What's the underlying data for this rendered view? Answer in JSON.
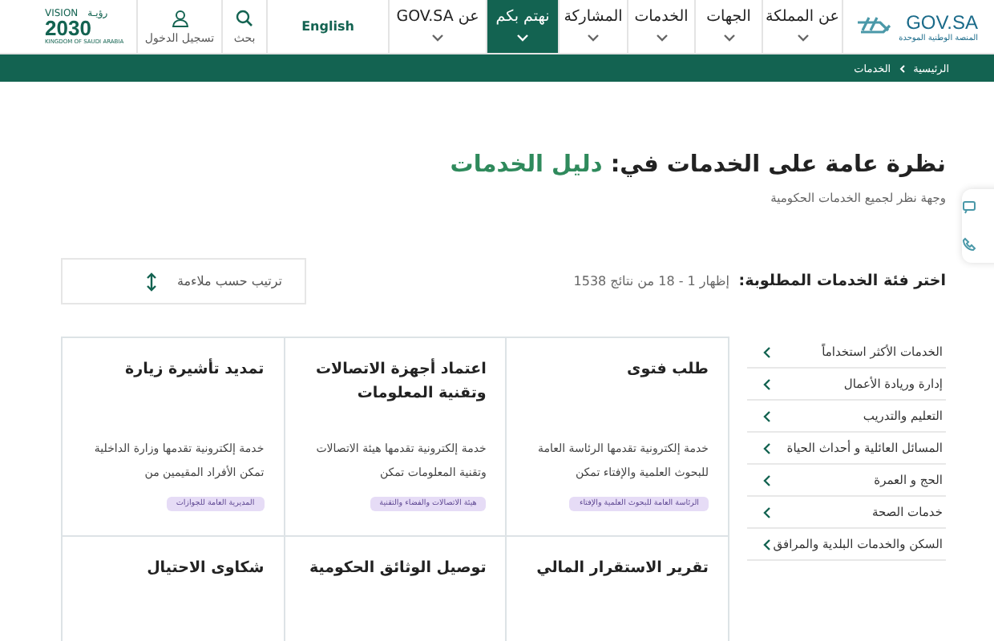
{
  "header": {
    "logo": {
      "name": "GOV.SA",
      "tagline": "المنصة الوطنية الموحدة"
    },
    "nav": [
      {
        "label": "عن المملكة",
        "dropdown": true,
        "selected": false
      },
      {
        "label": "الجهات",
        "dropdown": true,
        "selected": false
      },
      {
        "label": "الخدمات",
        "dropdown": true,
        "selected": false
      },
      {
        "label": "المشاركة",
        "dropdown": true,
        "selected": false
      },
      {
        "label": "نهتم بكم",
        "dropdown": true,
        "selected": true
      },
      {
        "label": "عن GOV.SA",
        "dropdown": true,
        "selected": false
      }
    ],
    "language": "English",
    "search": "بحث",
    "login": "تسجيل الدخول",
    "vision": {
      "word": "VISION",
      "arabic": "رؤيـة",
      "year": "2030",
      "country": "KINGDOM OF SAUDI ARABIA"
    }
  },
  "breadcrumb": [
    "الرئيسية",
    "الخدمات"
  ],
  "page": {
    "title": "نظرة عامة على الخدمات في:",
    "title_highlight": "دليل الخدمات",
    "subtitle": "وجهة نظر لجميع الخدمات الحكومية"
  },
  "filter_label": "اختر فئة الخدمات المطلوبة:",
  "results": "إظهار 1 - 18 من نتائج 1538",
  "sort": "ترتيب حسب  ملاءمة",
  "categories": [
    {
      "label": "الخدمات الأكثر استخداماً"
    },
    {
      "label": "إدارة وريادة الأعمال"
    },
    {
      "label": "التعليم والتدريب"
    },
    {
      "label": "المسائل العائلية و أحداث الحياة"
    },
    {
      "label": "الحج و العمرة"
    },
    {
      "label": "خدمات الصحة"
    },
    {
      "label": "السكن والخدمات البلدية والمرافق"
    }
  ],
  "services": [
    {
      "title": "طلب فتوى",
      "description": "خدمة إلكترونية تقدمها الرئاسة العامة للبحوث العلمية والإفتاء تمكن",
      "agency": "الرئاسة العامة للبحوث العلمية والإفتاء"
    },
    {
      "title": "اعتماد أجهزة الاتصالات وتقنية المعلومات",
      "description": "خدمة إلكترونية تقدمها هيئة الاتصالات وتقنية المعلومات تمكن",
      "agency": "هيئة الاتصالات والفضاء والتقنية"
    },
    {
      "title": "تمديد تأشيرة زيارة",
      "description": "خدمة إلكترونية تقدمها وزارة الداخلية تمكن الأفراد المقيمين من",
      "agency": "المديرية العامة للجوازات"
    },
    {
      "title": "تقرير الاستقرار المالي"
    },
    {
      "title": "توصيل الوثائق الحكومية"
    },
    {
      "title": "شكاوى الاحتيال"
    }
  ]
}
